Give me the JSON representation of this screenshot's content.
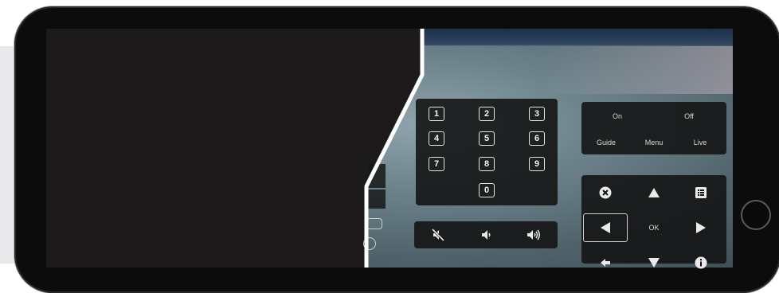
{
  "keypad": {
    "keys": [
      "1",
      "2",
      "3",
      "4",
      "5",
      "6",
      "7",
      "8",
      "9",
      "0"
    ]
  },
  "power": {
    "on": "On",
    "off": "Off",
    "guide": "Guide",
    "menu": "Menu",
    "live": "Live"
  },
  "nav": {
    "ok": "OK"
  },
  "volume": {
    "icons": [
      "mute-icon",
      "volume-down-icon",
      "volume-up-icon"
    ]
  },
  "colors": {
    "panel_bg": "#121212",
    "room_tint": "#6f858e",
    "left_bg": "#e9e9eb"
  }
}
